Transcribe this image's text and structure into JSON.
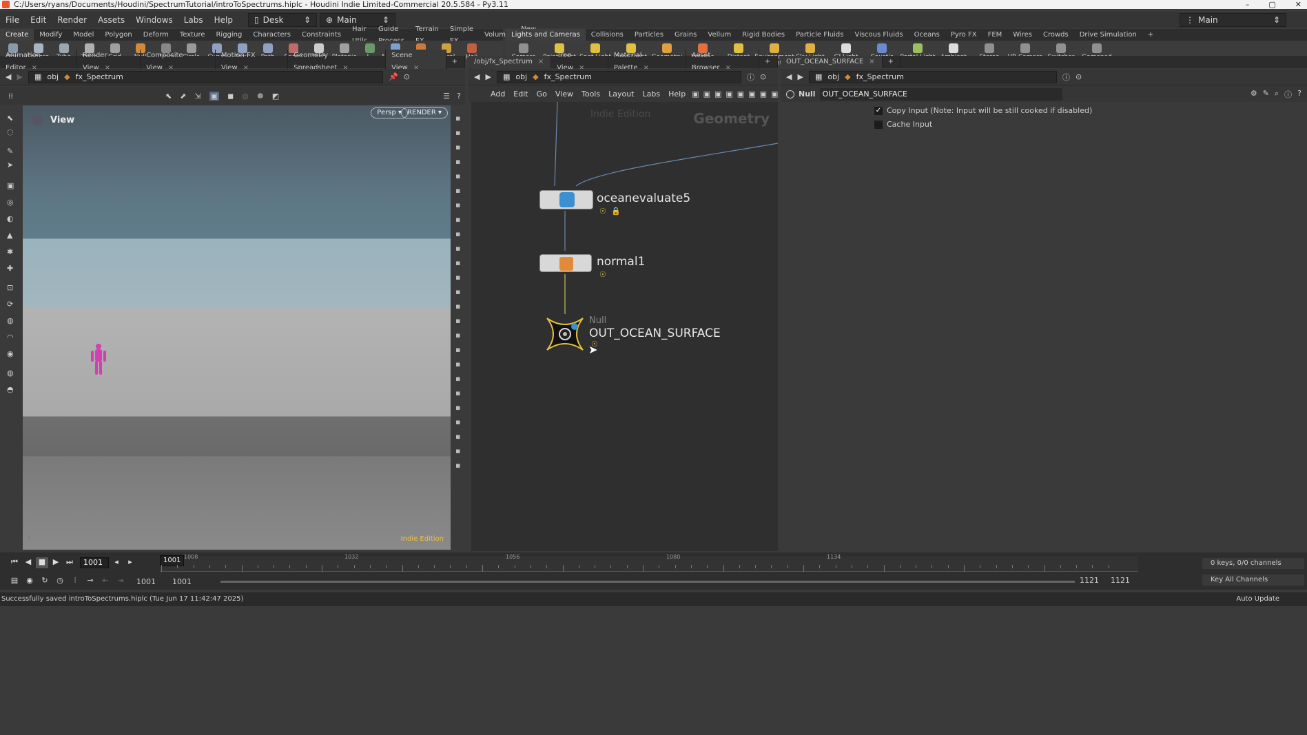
{
  "title": "C:/Users/ryans/Documents/Houdini/SpectrumTutorial/introToSpectrums.hiplc - Houdini Indie Limited-Commercial 20.5.584 - Py3.11",
  "menu": [
    "File",
    "Edit",
    "Render",
    "Assets",
    "Windows",
    "Labs",
    "Help"
  ],
  "desk": {
    "label": "Desk"
  },
  "main_desk": {
    "label": "Main"
  },
  "right_desk": {
    "label": "Main"
  },
  "shelf_tabs_left": [
    "Create",
    "Modify",
    "Model",
    "Polygon",
    "Deform",
    "Texture",
    "Rigging",
    "Characters",
    "Constraints",
    "Hair Utils",
    "Guide Process",
    "Terrain FX",
    "Simple FX",
    "Volume",
    "New Shelf"
  ],
  "shelf_tabs_right": [
    "Lights and Cameras",
    "Collisions",
    "Particles",
    "Grains",
    "Vellum",
    "Rigid Bodies",
    "Particle Fluids",
    "Viscous Fluids",
    "Oceans",
    "Pyro FX",
    "FEM",
    "Wires",
    "Crowds",
    "Drive Simulation"
  ],
  "tools_left": [
    {
      "label": "Box",
      "color": "#8a9aa8"
    },
    {
      "label": "Sphere",
      "color": "#a8b4bf"
    },
    {
      "label": "Tube",
      "color": "#9aa6b0"
    },
    {
      "label": "Torus",
      "color": "#b0b0b0"
    },
    {
      "label": "Grid",
      "color": "#a0a0a0"
    },
    {
      "label": "Null",
      "color": "#d08a3a"
    },
    {
      "label": "Line",
      "color": "#888"
    },
    {
      "label": "Circle",
      "color": "#999"
    },
    {
      "label": "Curve Bezier",
      "color": "#8fa0c0"
    },
    {
      "label": "Draw Curve",
      "color": "#8fa0c0"
    },
    {
      "label": "Path",
      "color": "#8fa0c0"
    },
    {
      "label": "Spray Paint",
      "color": "#c06a6a"
    },
    {
      "label": "Font",
      "color": "#cccccc"
    },
    {
      "label": "Platonic Solids",
      "color": "#a0a0a0"
    },
    {
      "label": "L-System",
      "color": "#6a9a6a"
    },
    {
      "label": "Metaball",
      "color": "#7aa0d0"
    },
    {
      "label": "File",
      "color": "#d07a3a"
    },
    {
      "label": "Spiral",
      "color": "#d0a040"
    },
    {
      "label": "Heli",
      "color": "#c06040"
    }
  ],
  "tools_right": [
    {
      "label": "Camera",
      "color": "#909090"
    },
    {
      "label": "Point Light",
      "color": "#e0c040"
    },
    {
      "label": "Spot Light",
      "color": "#e0c040"
    },
    {
      "label": "Area Light",
      "color": "#e0c040"
    },
    {
      "label": "Geometry Light",
      "color": "#e0a040"
    },
    {
      "label": "Volume Light",
      "color": "#e07040"
    },
    {
      "label": "Distant Light",
      "color": "#e0c040"
    },
    {
      "label": "Environment Light",
      "color": "#e0b040"
    },
    {
      "label": "Sky Light",
      "color": "#e0b040"
    },
    {
      "label": "GI Light",
      "color": "#dddddd"
    },
    {
      "label": "Caustic Light",
      "color": "#6a8ad0"
    },
    {
      "label": "Portal Light",
      "color": "#9ac060"
    },
    {
      "label": "Ambient Light",
      "color": "#dddddd"
    },
    {
      "label": "Stereo Camera",
      "color": "#909090"
    },
    {
      "label": "VR Camera",
      "color": "#909090"
    },
    {
      "label": "Switcher",
      "color": "#909090"
    },
    {
      "label": "Gamepad Camera",
      "color": "#909090"
    }
  ],
  "left_tabs": [
    "Animation Editor",
    "Render View",
    "Composite View",
    "Motion FX View",
    "Geometry Spreadsheet",
    "Scene View"
  ],
  "mid_tabs": [
    "/obj/fx_Spectrum",
    "Tree View",
    "Material Palette",
    "Asset Browser"
  ],
  "right_tabs": [
    "OUT_OCEAN_SURFACE"
  ],
  "left_path": {
    "root": "obj",
    "node": "fx_Spectrum"
  },
  "mid_path": {
    "root": "obj",
    "node": "fx_Spectrum"
  },
  "right_path": {
    "root": "obj",
    "node": "fx_Spectrum"
  },
  "net_menu": [
    "Add",
    "Edit",
    "Go",
    "View",
    "Tools",
    "Layout",
    "Labs",
    "Help"
  ],
  "viewport": {
    "label": "View",
    "persp": "Persp ▾",
    "render": "RENDER ▾",
    "watermark": "Indie Edition"
  },
  "network": {
    "watermark": "Indie Edition",
    "context": "Geometry",
    "nodes": [
      {
        "name": "oceanevaluate5"
      },
      {
        "name": "normal1"
      },
      {
        "type": "Null",
        "name": "OUT_OCEAN_SURFACE"
      }
    ]
  },
  "params": {
    "node_type": "Null",
    "node_name": "OUT_OCEAN_SURFACE",
    "copy_input_label": "Copy Input (Note: Input will be still cooked if disabled)",
    "copy_input_checked": true,
    "cache_input_label": "Cache Input",
    "cache_input_checked": false
  },
  "timeline": {
    "current_frame": "1001",
    "cursor_frame": "1001",
    "ticks": [
      "1008",
      "1032",
      "1056",
      "1080",
      "1134"
    ],
    "range_start": "1001",
    "range_start2": "1001",
    "range_end": "1121",
    "range_end2": "1121",
    "keys_info": "0 keys, 0/0 channels",
    "key_all": "Key All Channels"
  },
  "status": {
    "message": "Successfully saved introToSpectrums.hiplc (Tue Jun 17 11:42:47 2025)",
    "auto_update": "Auto Update"
  }
}
